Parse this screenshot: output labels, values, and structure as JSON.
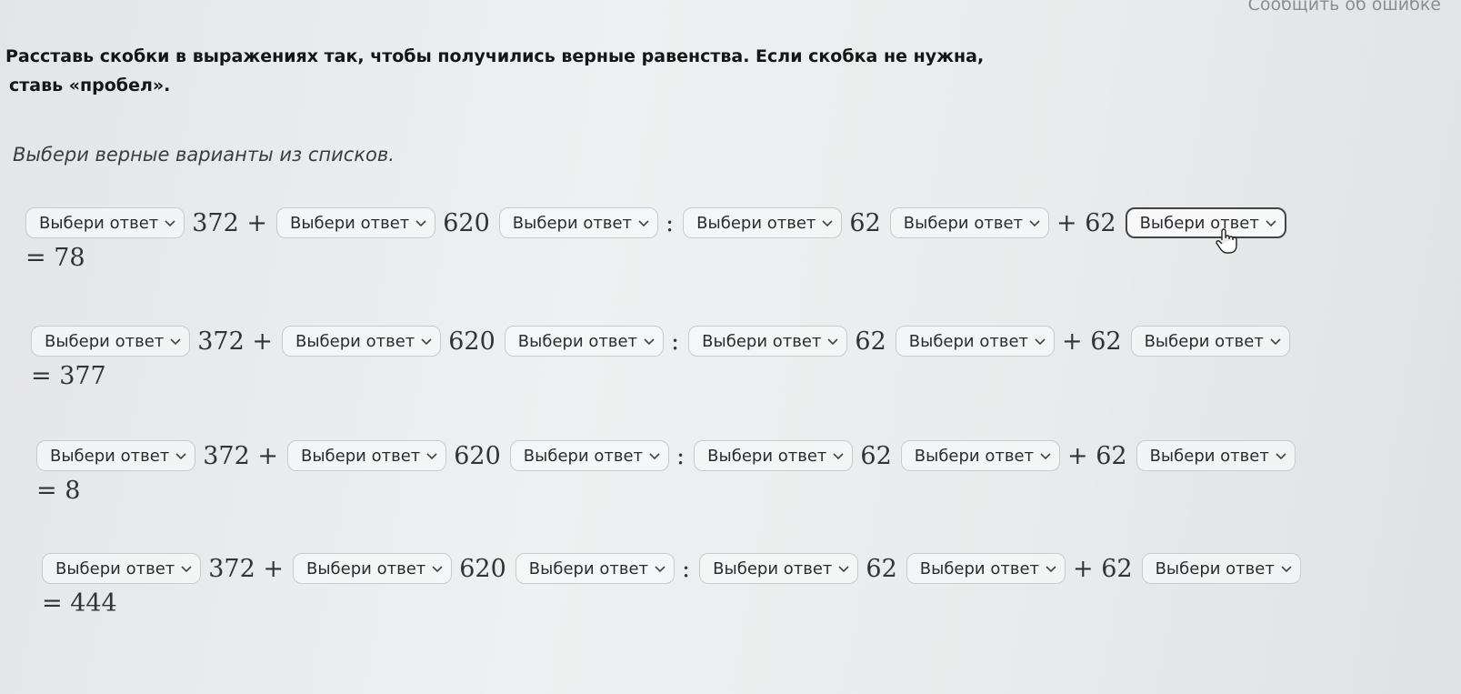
{
  "header": {
    "report_error": "Сообщить об ошибке"
  },
  "task": {
    "line1": "Расставь скобки в выражениях так, чтобы получились верные равенства. Если скобка не нужна,",
    "line2": "ставь «пробел».",
    "hint": "Выбери верные варианты из списков."
  },
  "expr": {
    "placeholder": "Выбери ответ",
    "t1": "372 +",
    "t2": "620",
    "t3": ":",
    "t4": "62",
    "t5": "+ 62"
  },
  "rows": [
    {
      "result": "= 78"
    },
    {
      "result": "= 377"
    },
    {
      "result": "= 8"
    },
    {
      "result": "= 444"
    }
  ]
}
